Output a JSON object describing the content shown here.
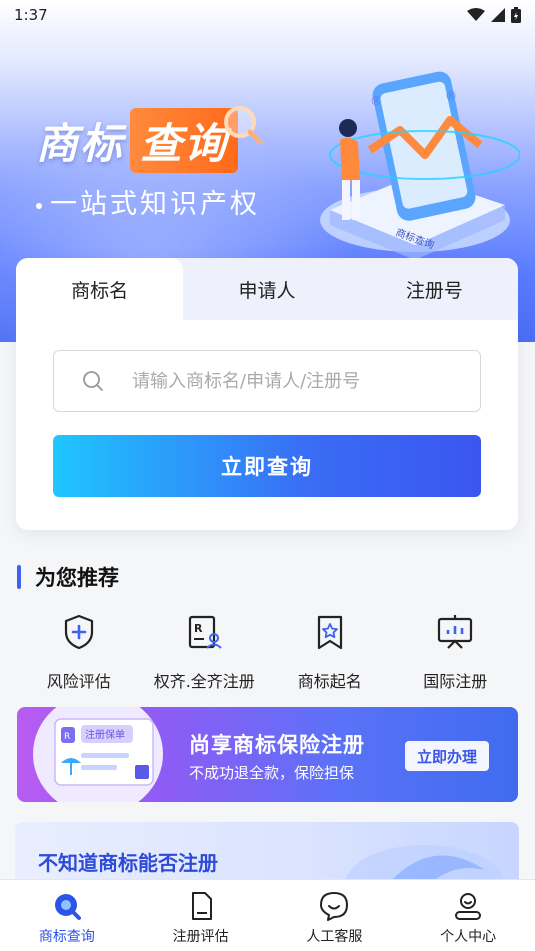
{
  "status_bar": {
    "time": "1:37"
  },
  "hero": {
    "title_part1": "商标",
    "title_part2": "查询",
    "subtitle": "一站式知识产权",
    "art_caption": "商标查询"
  },
  "search_card": {
    "tabs": [
      {
        "label": "商标名",
        "active": true
      },
      {
        "label": "申请人",
        "active": false
      },
      {
        "label": "注册号",
        "active": false
      }
    ],
    "search_placeholder": "请输入商标名/申请人/注册号",
    "search_button": "立即查询"
  },
  "recommend": {
    "title": "为您推荐",
    "items": [
      {
        "label": "风险评估",
        "icon": "shield-plus-icon"
      },
      {
        "label": "权齐.全齐注册",
        "icon": "registration-form-icon"
      },
      {
        "label": "商标起名",
        "icon": "bookmark-star-icon"
      },
      {
        "label": "国际注册",
        "icon": "presentation-chart-icon"
      }
    ]
  },
  "insurance_banner": {
    "doc_label": "注册保单",
    "title": "尚享商标保险注册",
    "subtitle": "不成功退全款，保险担保",
    "button": "立即办理"
  },
  "promo2": {
    "title": "不知道商标能否注册"
  },
  "bottom_nav": [
    {
      "label": "商标查询",
      "icon": "search-q-icon",
      "active": true
    },
    {
      "label": "注册评估",
      "icon": "document-icon",
      "active": false
    },
    {
      "label": "人工客服",
      "icon": "chat-bubble-icon",
      "active": false
    },
    {
      "label": "个人中心",
      "icon": "user-icon",
      "active": false
    }
  ],
  "colors": {
    "accent": "#3e63f0",
    "button_start": "#1fc6ff",
    "button_end": "#3b56f0",
    "orange": "#ff7a2a"
  }
}
